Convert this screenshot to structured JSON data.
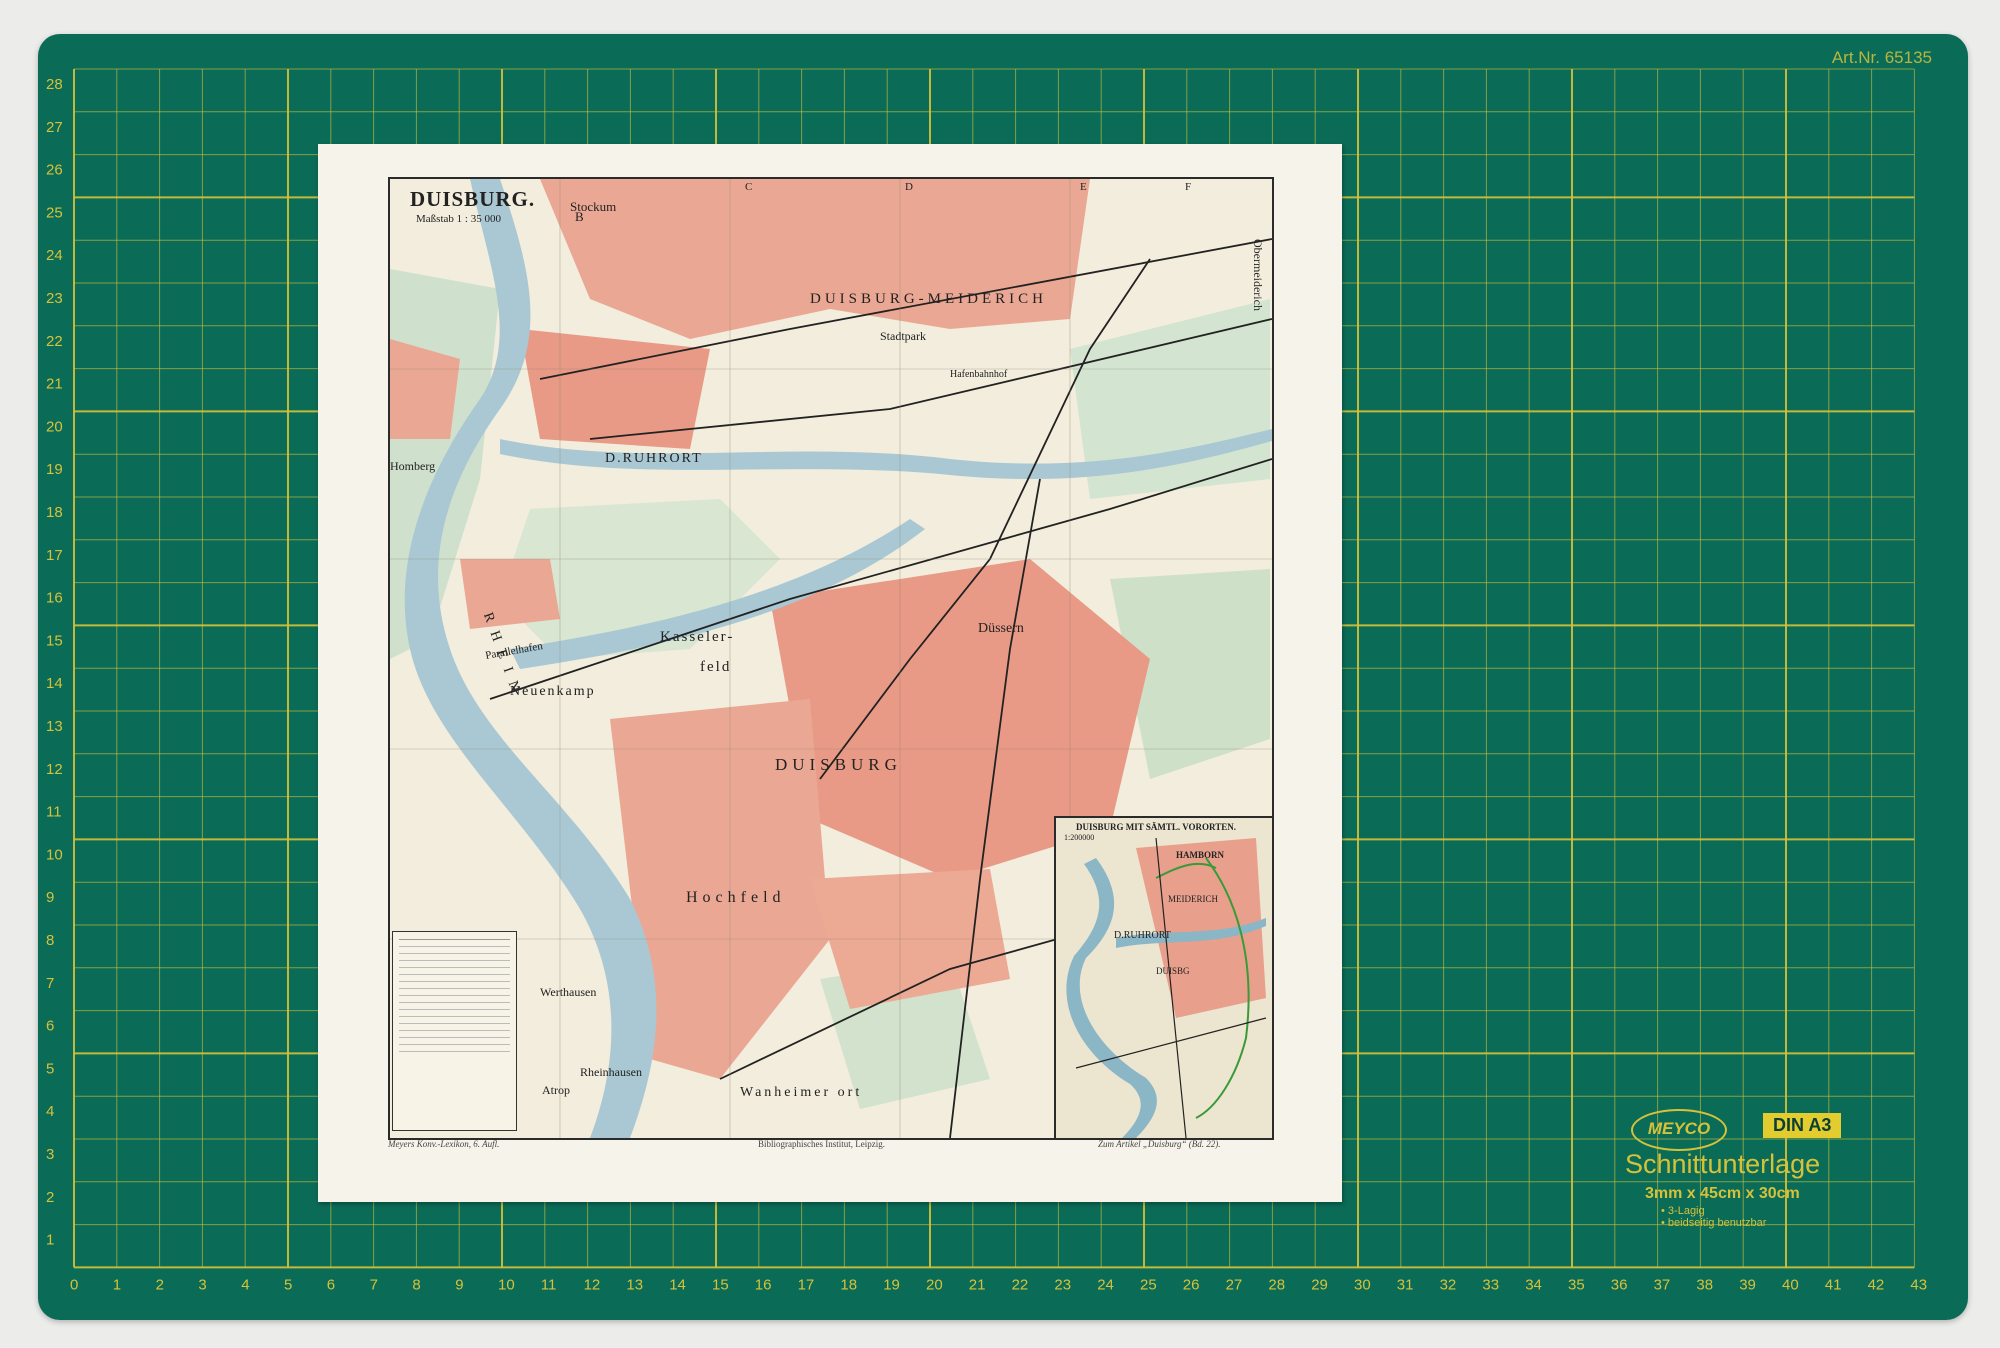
{
  "mat": {
    "article_number": "Art.Nr. 65135",
    "brand": "MEYCO",
    "size_badge": "DIN A3",
    "product_name": "Schnittunterlage",
    "dimensions": "3mm x 45cm x 30cm",
    "features": [
      "3-Lagig",
      "beidseitig benutzbar"
    ],
    "ruler_bottom": [
      "0",
      "1",
      "2",
      "3",
      "4",
      "5",
      "6",
      "7",
      "8",
      "9",
      "10",
      "11",
      "12",
      "13",
      "14",
      "15",
      "16",
      "17",
      "18",
      "19",
      "20",
      "21",
      "22",
      "23",
      "24",
      "25",
      "26",
      "27",
      "28",
      "29",
      "30",
      "31",
      "32",
      "33",
      "34",
      "35",
      "36",
      "37",
      "38",
      "39",
      "40",
      "41",
      "42",
      "43"
    ],
    "ruler_left": [
      "28",
      "27",
      "26",
      "25",
      "24",
      "23",
      "22",
      "21",
      "20",
      "19",
      "18",
      "17",
      "16",
      "15",
      "14",
      "13",
      "12",
      "11",
      "10",
      "9",
      "8",
      "7",
      "6",
      "5",
      "4",
      "3",
      "2",
      "1"
    ],
    "colors": {
      "mat": "#0a6b57",
      "lines": "#d6c23a"
    }
  },
  "map": {
    "title": "DUISBURG.",
    "scale": "Maßstab 1 : 35 000",
    "column_letters": [
      "B",
      "C",
      "D",
      "E",
      "F"
    ],
    "labels": {
      "stockum": "Stockum",
      "meiderich": "DUISBURG-MEIDERICH",
      "obermeiderich": "Obermeiderich",
      "ruhrort": "D.RUHRORT",
      "homberg": "Homberg",
      "kasseler": "Kasseler-",
      "feld": "feld",
      "duessern": "Düssern",
      "neuenkamp": "Neuenkamp",
      "duisburg": "DUISBURG",
      "hochfeld": "Hochfeld",
      "werthausen": "Werthausen",
      "rheinhausen": "Rheinhausen",
      "atrop": "Atrop",
      "wanheimerort": "Wanheimer ort",
      "rhein": "RHEIN",
      "parallelhafen": "Parallelhafen",
      "stadtpark": "Stadtpark",
      "hafenbahnhof": "Hafenbahnhof"
    },
    "inset_title": "DUISBURG MIT SÄMTL. VORORTEN.",
    "inset_scale": "1:200000",
    "inset_labels": [
      "HAMBORN",
      "MEIDERICH",
      "D.RUHRORT",
      "DUISBG"
    ],
    "footer_left": "Meyers Konv.-Lexikon, 6. Aufl.",
    "footer_center": "Bibliographisches Institut, Leipzig.",
    "footer_right": "Zum Artikel „Duisburg“ (Bd. 22).",
    "colors": {
      "town": "#e89a86",
      "water": "#a9c8d4",
      "green": "#cfe0cc",
      "rail": "#222222"
    }
  }
}
